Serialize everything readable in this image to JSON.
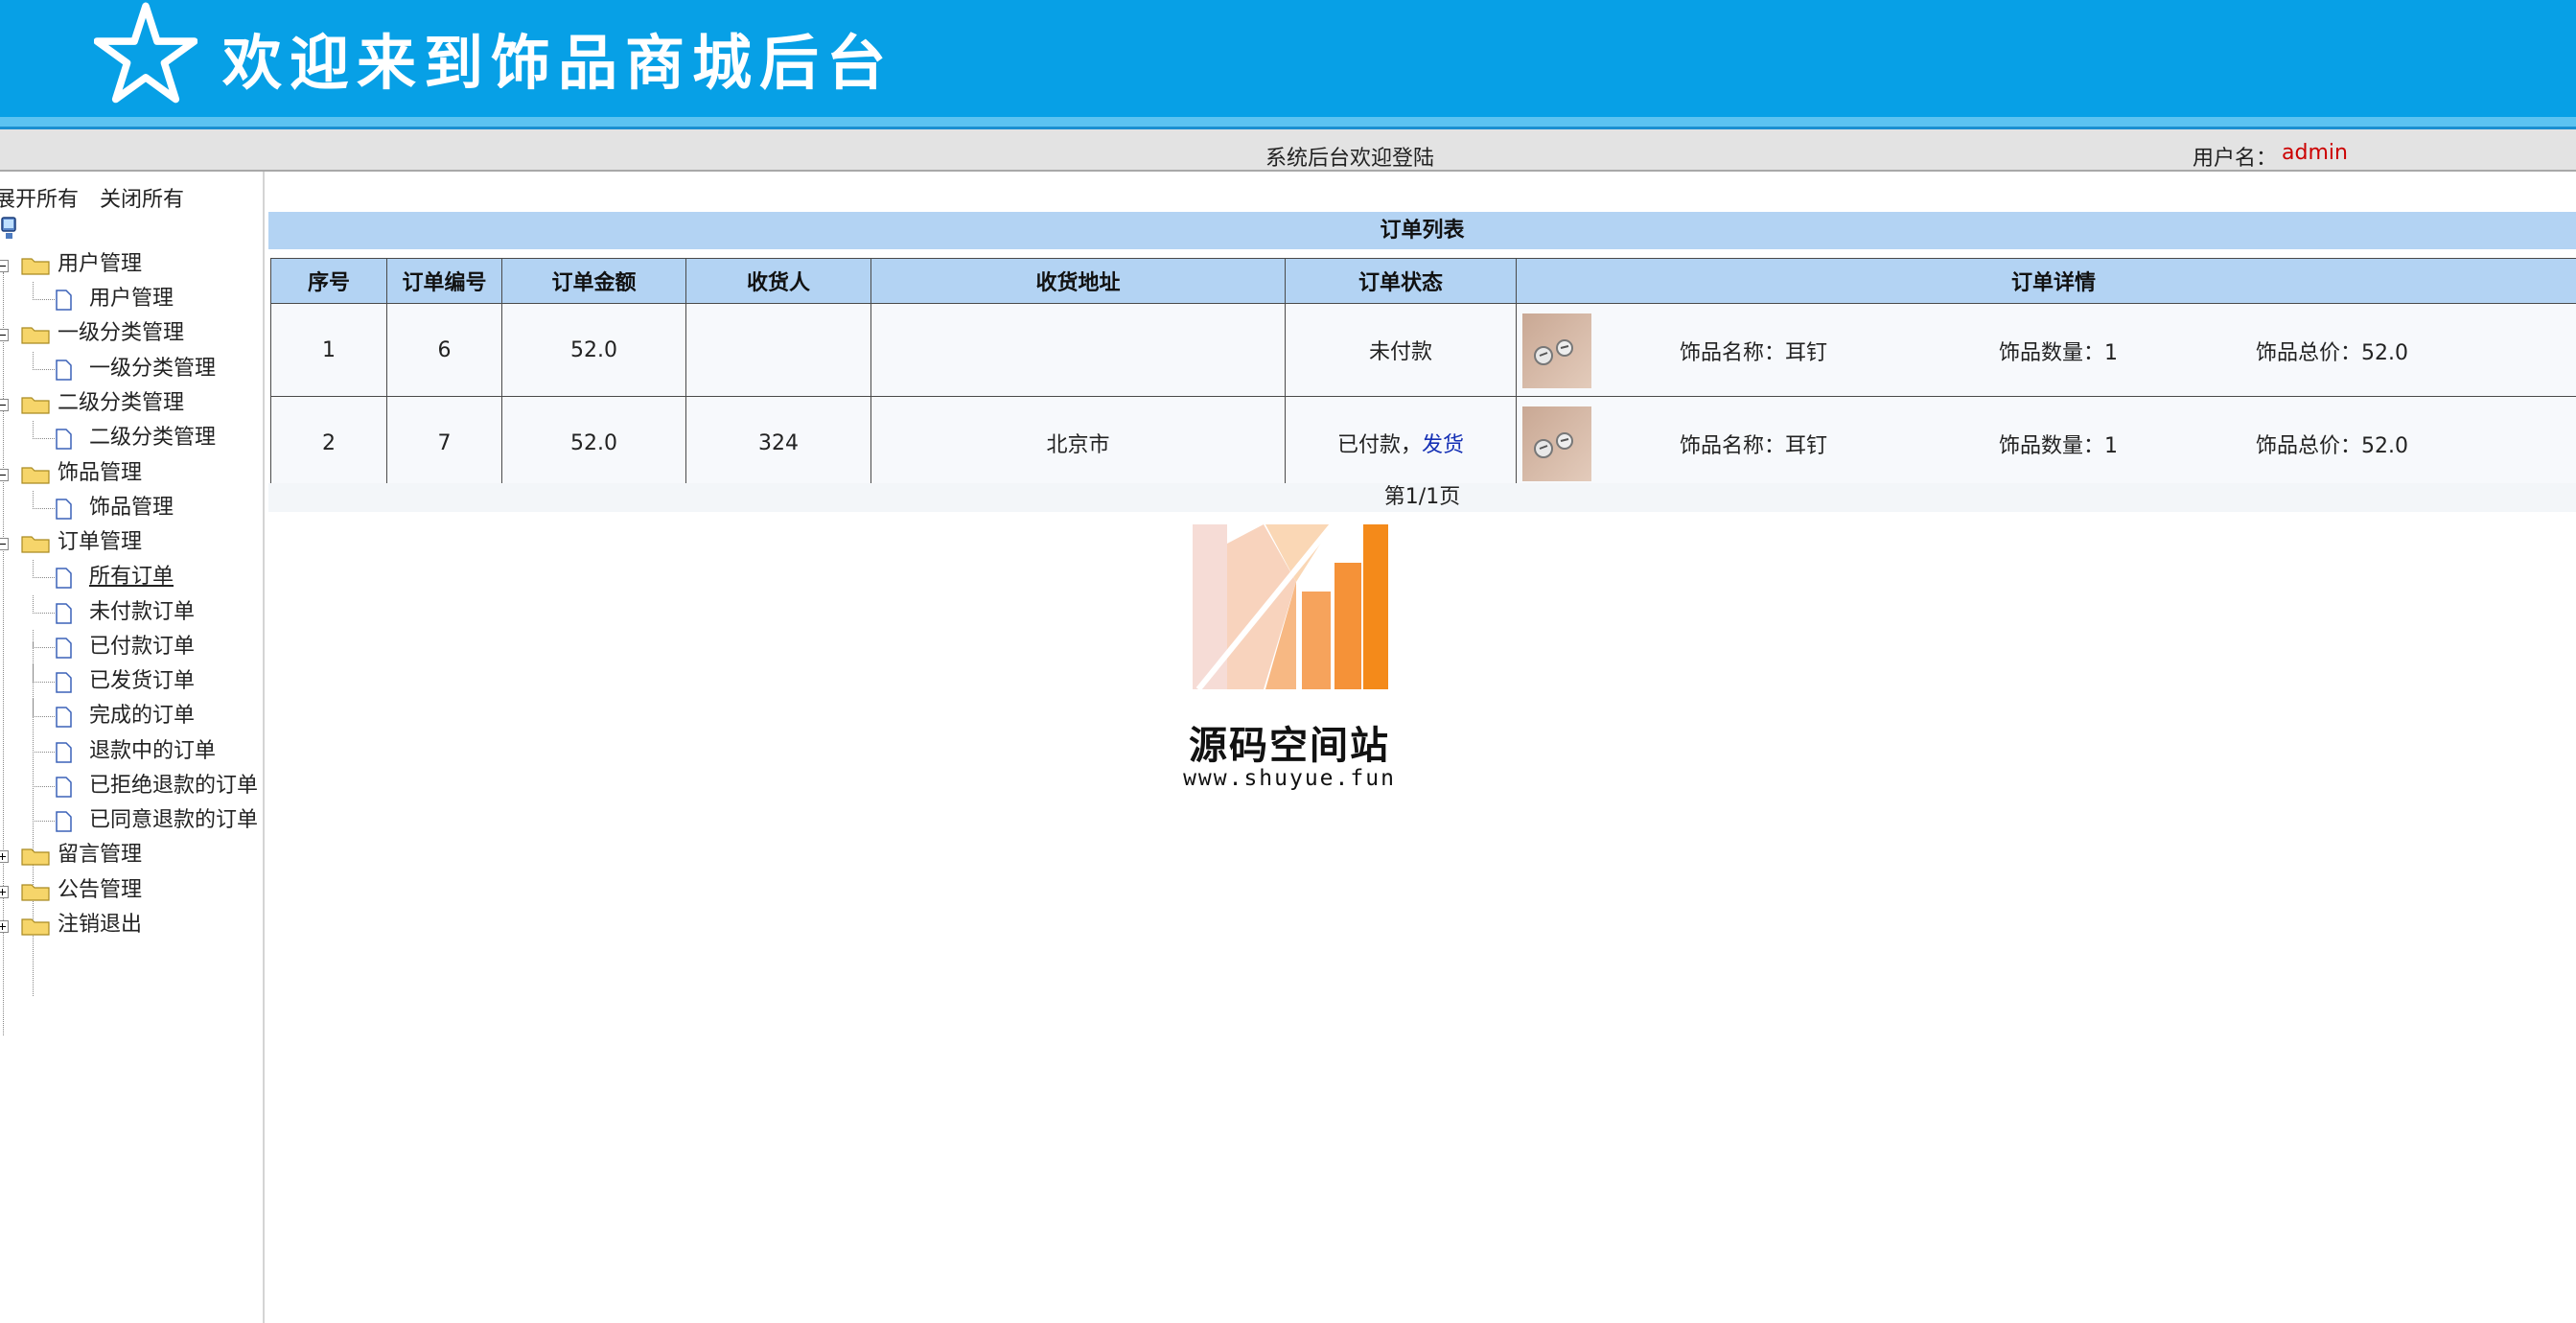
{
  "header": {
    "title": "欢迎来到饰品商城后台",
    "welcome": "系统后台欢迎登陆",
    "user_label": "用户名：",
    "user_name": "admin"
  },
  "sidebar": {
    "expand_all": "展开所有",
    "collapse_all": "关闭所有",
    "groups": [
      {
        "label": "用户管理",
        "items": [
          "用户管理"
        ]
      },
      {
        "label": "一级分类管理",
        "items": [
          "一级分类管理"
        ]
      },
      {
        "label": "二级分类管理",
        "items": [
          "二级分类管理"
        ]
      },
      {
        "label": "饰品管理",
        "items": [
          "饰品管理"
        ]
      },
      {
        "label": "订单管理",
        "items": [
          "所有订单",
          "未付款订单",
          "已付款订单",
          "已发货订单",
          "完成的订单",
          "退款中的订单",
          "已拒绝退款的订单",
          "已同意退款的订单"
        ]
      },
      {
        "label": "留言管理",
        "items": []
      },
      {
        "label": "公告管理",
        "items": []
      },
      {
        "label": "注销退出",
        "items": []
      }
    ]
  },
  "main": {
    "list_title": "订单列表",
    "columns": [
      "序号",
      "订单编号",
      "订单金额",
      "收货人",
      "收货地址",
      "订单状态",
      "订单详情"
    ],
    "rows": [
      {
        "seq": "1",
        "order_no": "6",
        "amount": "52.0",
        "receiver": "",
        "address": "",
        "status": "未付款",
        "action": "",
        "detail_name": "饰品名称：耳钉",
        "detail_qty": "饰品数量：1",
        "detail_total": "饰品总价：52.0"
      },
      {
        "seq": "2",
        "order_no": "7",
        "amount": "52.0",
        "receiver": "324",
        "address": "北京市",
        "status": "已付款，",
        "action": "发货",
        "detail_name": "饰品名称：耳钉",
        "detail_qty": "饰品数量：1",
        "detail_total": "饰品总价：52.0"
      }
    ],
    "pagination": "第1/1页"
  },
  "watermark": {
    "name": "源码空间站",
    "url": "www.shuyue.fun"
  },
  "colors": {
    "banner": "#07a0e6",
    "table_header": "#b3d3f3",
    "username": "#cc0000",
    "link": "#1530b5"
  }
}
